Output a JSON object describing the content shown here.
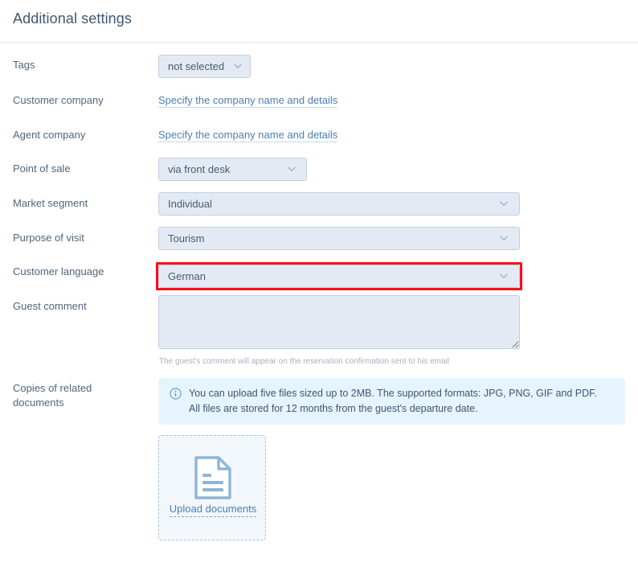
{
  "header": {
    "title": "Additional settings"
  },
  "colors": {
    "accent_link": "#4a7fb5",
    "label_text": "#51657c",
    "field_bg": "#e3eaf3",
    "field_border": "#c3cfe0",
    "highlight_red": "#fc0d1b",
    "banner_bg": "#e6f4fd",
    "upload_bg": "#f2f7fb"
  },
  "form": {
    "tags": {
      "label": "Tags",
      "value": "not selected",
      "icon": "chevron-down-icon"
    },
    "customer_company": {
      "label": "Customer company",
      "link": "Specify the company name and details"
    },
    "agent_company": {
      "label": "Agent company",
      "link": "Specify the company name and details"
    },
    "point_of_sale": {
      "label": "Point of sale",
      "value": "via front desk",
      "icon": "chevron-down-icon"
    },
    "market_segment": {
      "label": "Market segment",
      "value": "Individual",
      "icon": "chevron-down-icon"
    },
    "purpose_of_visit": {
      "label": "Purpose of visit",
      "value": "Tourism",
      "icon": "chevron-down-icon"
    },
    "customer_language": {
      "label": "Customer language",
      "value": "German",
      "icon": "chevron-down-icon",
      "highlighted": true
    },
    "guest_comment": {
      "label": "Guest comment",
      "value": "",
      "placeholder": "",
      "hint": "The guest's comment will appear on the reservation confirmation sent to his email"
    },
    "related_documents": {
      "label": "Copies of related documents",
      "banner": {
        "icon": "info-circle-icon",
        "line1": "You can upload five files sized up to 2MB. The supported formats: JPG, PNG, GIF and PDF.",
        "line2": "All files are stored for 12 months from the guest's departure date."
      },
      "upload": {
        "icon": "document-icon",
        "link": "Upload documents"
      }
    }
  }
}
